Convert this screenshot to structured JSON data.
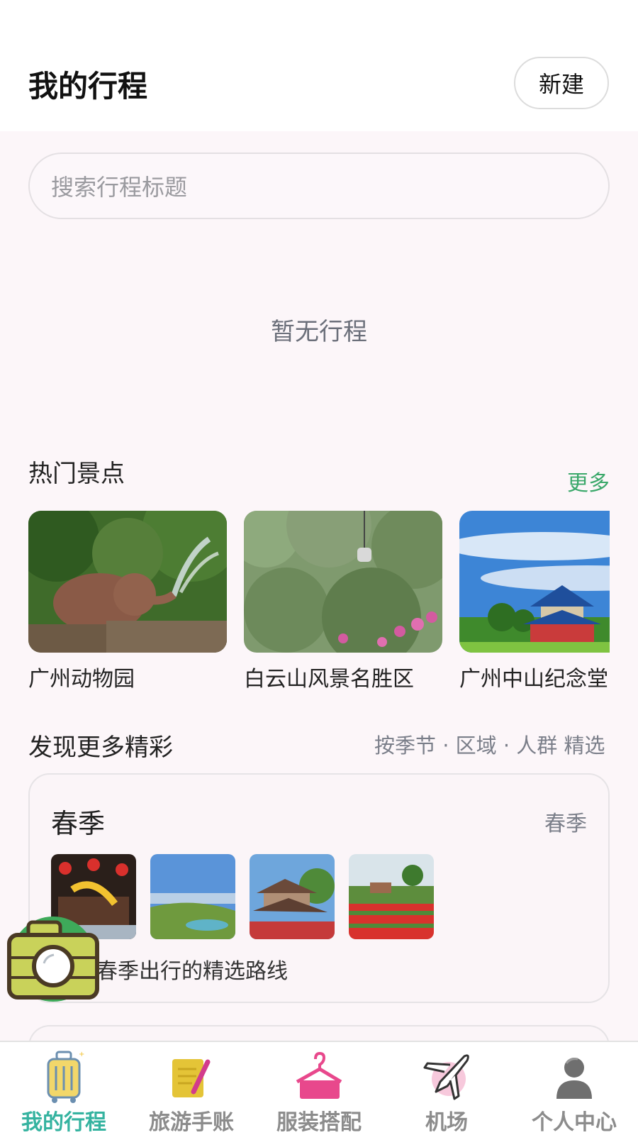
{
  "header": {
    "title": "我的行程",
    "new_label": "新建"
  },
  "search": {
    "placeholder": "搜索行程标题"
  },
  "trips": {
    "empty_text": "暂无行程"
  },
  "hot_spots": {
    "title": "热门景点",
    "more_label": "更多",
    "items": [
      {
        "name": "广州动物园",
        "image": "elephant-photo"
      },
      {
        "name": "白云山风景名胜区",
        "image": "cable-car-mountain-photo"
      },
      {
        "name": "广州中山纪念堂",
        "image": "memorial-hall-photo"
      }
    ]
  },
  "discover": {
    "title": "发现更多精彩",
    "filter_note": "按季节 · 区域 · 人群 精选",
    "card": {
      "title": "春季",
      "tag": "春季",
      "thumbnails": [
        "festival-lanterns-photo",
        "lake-landscape-photo",
        "pavilion-photo",
        "flower-garden-photo"
      ],
      "description": "春季出行的精选路线"
    }
  },
  "fab": {
    "icon": "camera-icon"
  },
  "tabbar": {
    "active_color": "#35b3a0",
    "items": [
      {
        "label": "我的行程",
        "icon": "suitcase-icon",
        "active": true
      },
      {
        "label": "旅游手账",
        "icon": "notebook-pen-icon",
        "active": false
      },
      {
        "label": "服装搭配",
        "icon": "hanger-icon",
        "active": false
      },
      {
        "label": "机场",
        "icon": "airplane-icon",
        "active": false
      },
      {
        "label": "个人中心",
        "icon": "person-icon",
        "active": false
      }
    ]
  },
  "colors": {
    "accent_green": "#3aa86a",
    "page_bg": "#fcf6f9"
  }
}
